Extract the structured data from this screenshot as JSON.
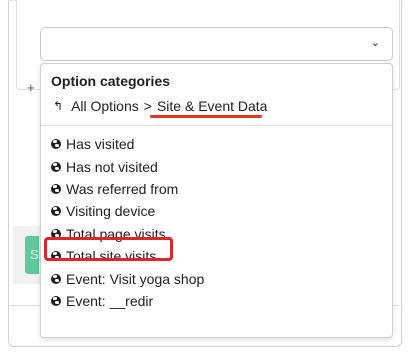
{
  "select": {
    "value": ""
  },
  "background": {
    "plus_hint": "+",
    "button_label": "S"
  },
  "dropdown": {
    "header": "Option categories",
    "breadcrumb": {
      "root": "All Options",
      "separator": ">",
      "current": "Site & Event Data"
    },
    "options": [
      {
        "label": "Has visited",
        "icon": "globe-icon"
      },
      {
        "label": "Has not visited",
        "icon": "globe-icon"
      },
      {
        "label": "Was referred from",
        "icon": "globe-icon"
      },
      {
        "label": "Visiting device",
        "icon": "globe-icon"
      },
      {
        "label": "Total page visits",
        "icon": "globe-icon"
      },
      {
        "label": "Total site visits",
        "icon": "globe-icon"
      },
      {
        "label": "Event: Visit yoga shop",
        "icon": "globe-icon"
      },
      {
        "label": "Event: __redir",
        "icon": "globe-icon"
      }
    ]
  },
  "colors": {
    "annotation_red": "#e0242c",
    "button_green": "#5fc99a"
  }
}
